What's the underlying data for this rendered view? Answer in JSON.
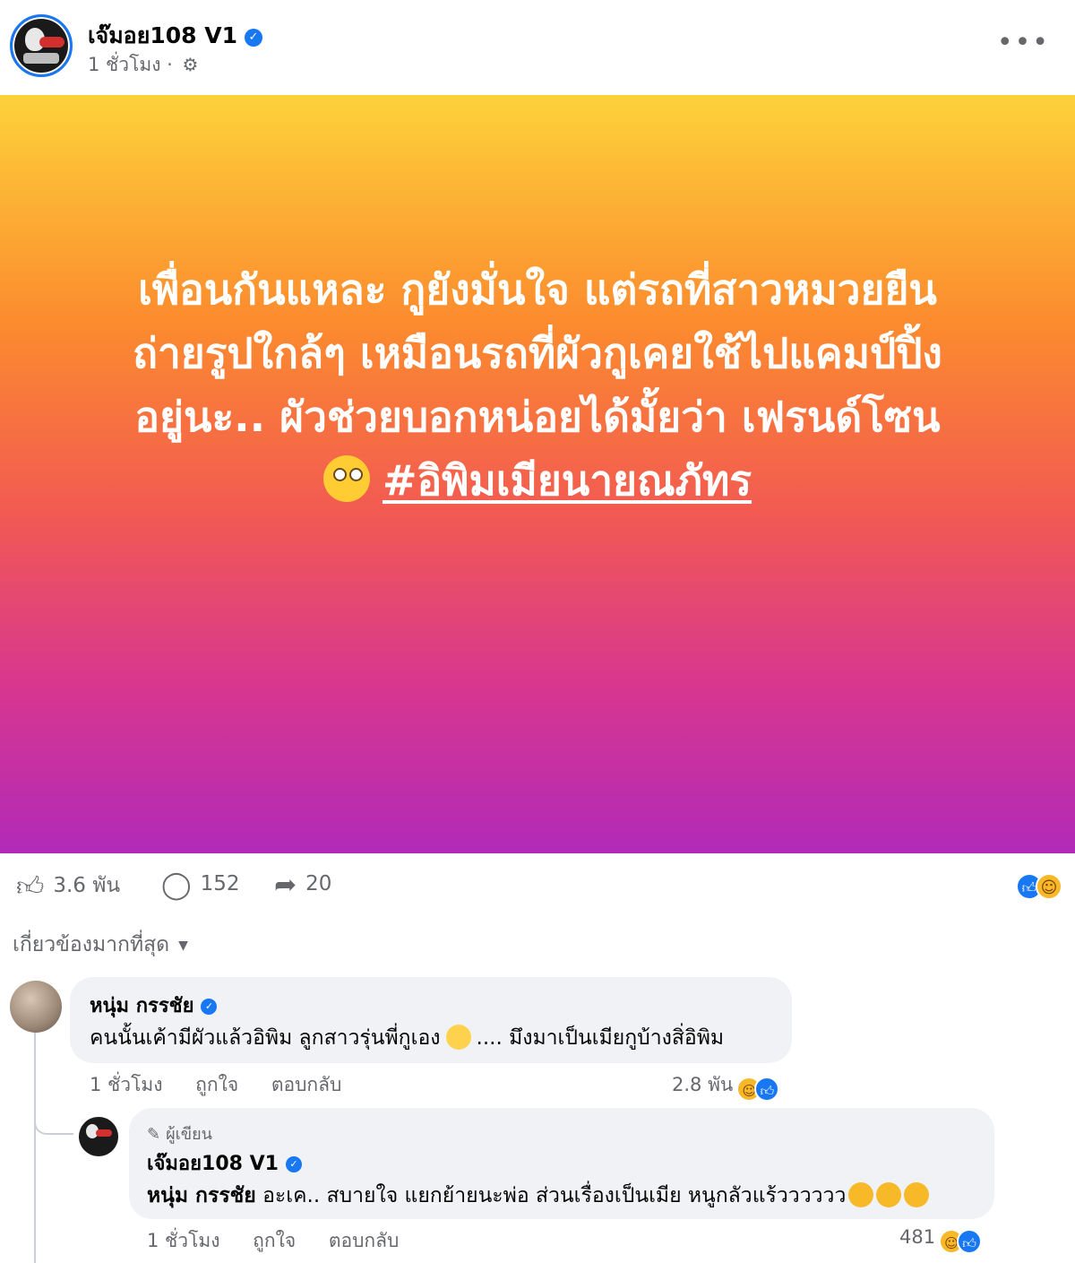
{
  "post": {
    "author": "เจ๊มอย108 V1",
    "time": "1 ชั่วโมง ·",
    "text_lines": [
      "เพื่อนกันแหละ กูยังมั่นใจ แต่รถที่สาวหมวยยืน",
      "ถ่ายรูปใกล้ๆ เหมือนรถที่ผัวกูเคยใช้ไปแคมป์ปิ้ง",
      "อยู่นะ.. ผัวช่วยบอกหน่อยได้มั้ยว่า เฟรนด์โซน"
    ],
    "hashtag": "#อิพิมเมียนายณภัทร",
    "background": [
      "#fdd23a",
      "#fc8b2e",
      "#f25a52",
      "#d8368f",
      "#b12ab8"
    ]
  },
  "actions": {
    "likes": "3.6 พัน",
    "comments": "152",
    "shares": "20"
  },
  "icons": {
    "like": "thumbs-up-icon",
    "comment": "comment-bubble-icon",
    "share": "share-arrow-icon",
    "settings": "gear-icon",
    "more": "more-dots-icon"
  },
  "sort": {
    "label": "เกี่ยวข้องมากที่สุด"
  },
  "comments": [
    {
      "name": "หนุ่ม กรรชัย",
      "text_before": "คนนั้นเค้ามีผัวแล้วอิพิม ลูกสาวรุ่นพี่กูเอง",
      "text_after": ".... มึงมาเป็นเมียกูบ้างสิ่อิพิม",
      "time": "1 ชั่วโมง",
      "like_label": "ถูกใจ",
      "reply_label": "ตอบกลับ",
      "reaction_count": "2.8 พัน"
    },
    {
      "badge": "ผู้เขียน",
      "name": "เจ๊มอย108 V1",
      "mention": "หนุ่ม กรรชัย",
      "text": "อะเค.. สบายใจ แยกย้ายนะพ่อ ส่วนเรื่องเป็นเมีย หนูกลัวแร้วววววว",
      "time": "1 ชั่วโมง",
      "like_label": "ถูกใจ",
      "reply_label": "ตอบกลับ",
      "reaction_count": "481"
    }
  ]
}
